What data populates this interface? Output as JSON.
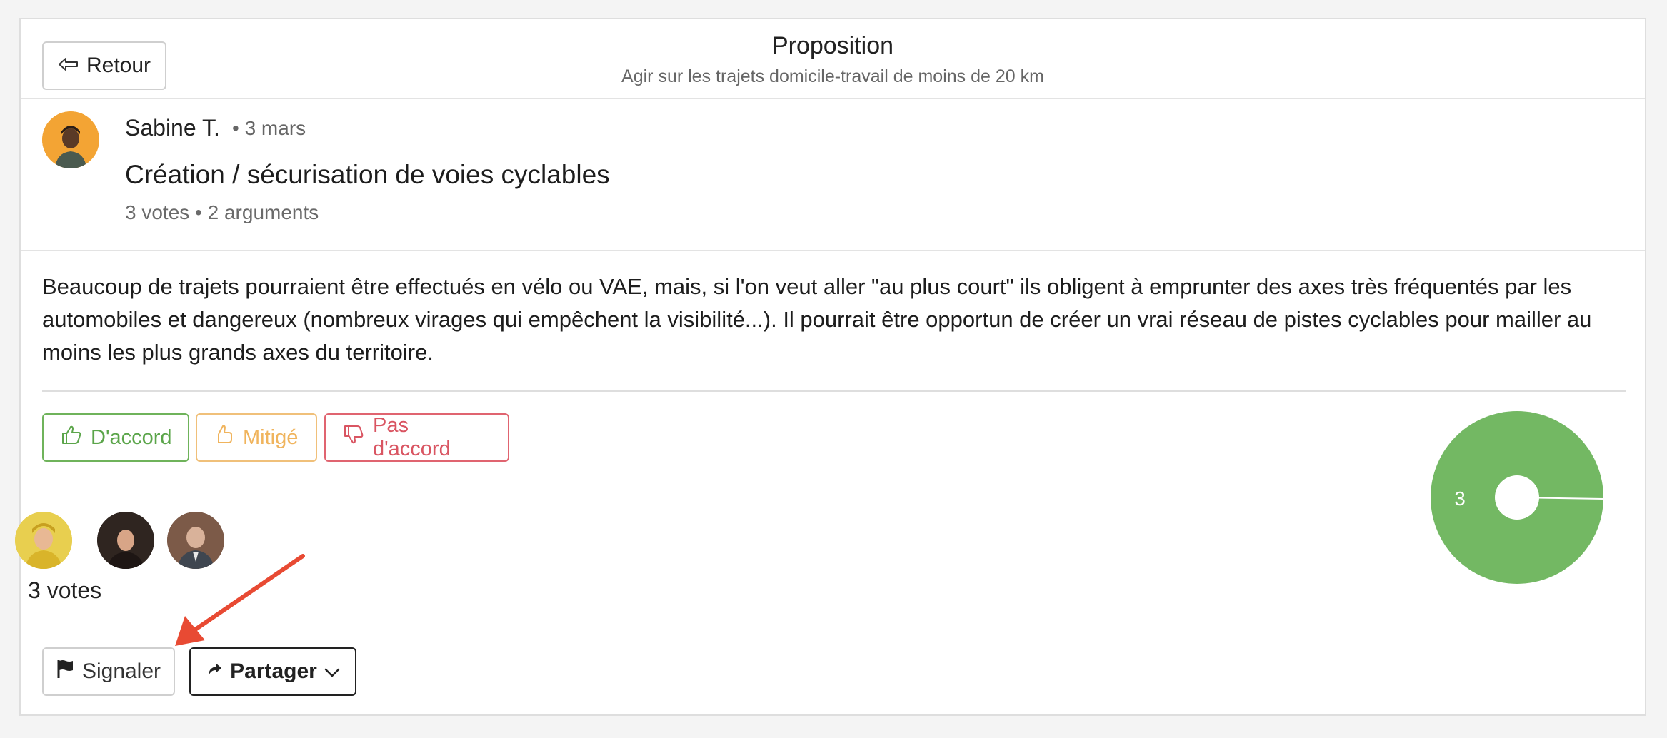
{
  "header": {
    "back_label": "Retour",
    "title": "Proposition",
    "subtitle": "Agir sur les trajets domicile-travail de moins de 20 km"
  },
  "author": {
    "name": "Sabine T.",
    "date": "• 3 mars"
  },
  "proposal": {
    "title": "Création / sécurisation de voies cyclables",
    "meta": "3 votes  •  2 arguments",
    "body": "Beaucoup de trajets pourraient être effectués en vélo ou VAE, mais, si l'on veut aller \"au plus court\" ils obligent à emprunter des axes très fréquentés par les automobiles et dangereux (nombreux virages qui empêchent la visibilité...). Il pourrait être opportun de créer un vrai réseau de pistes cyclables pour mailler au moins les plus grands axes du territoire."
  },
  "vote_buttons": {
    "agree": "D'accord",
    "mixed": "Mitigé",
    "disagree": "Pas d'accord"
  },
  "voters": {
    "count_label": "3 votes"
  },
  "actions": {
    "report": "Signaler",
    "share": "Partager"
  },
  "colors": {
    "agree": "#5ba54a",
    "mixed": "#f0b45d",
    "disagree": "#d95562",
    "pie_green": "#73b863"
  },
  "chart_data": {
    "type": "pie",
    "categories": [
      "D'accord"
    ],
    "values": [
      3
    ],
    "labels": [
      "3"
    ]
  }
}
